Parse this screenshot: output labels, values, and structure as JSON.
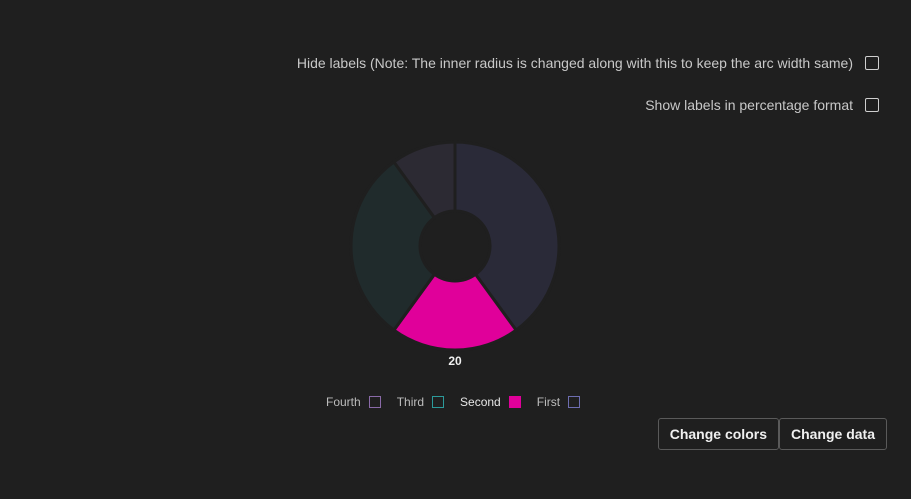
{
  "options": {
    "hide_labels": "Hide labels (Note: The inner radius is changed along with this to keep the arc width same)",
    "show_percentage": "Show labels in percentage format"
  },
  "buttons": {
    "change_colors": "Change colors",
    "change_data": "Change data"
  },
  "colors": {
    "background": "#1f1f1f",
    "first": "#2a2a38",
    "second": "#e0009a",
    "third": "#202b2c",
    "fourth": "#2c2a33",
    "first_legend_border": "#6d6db0",
    "third_legend_border": "#2c9a9a",
    "fourth_legend_border": "#8a6aa8"
  },
  "chart_data": {
    "type": "pie",
    "variant": "donut",
    "order": "clockwise from top",
    "slices": [
      {
        "name": "First",
        "value": 40,
        "color": "#2a2a38",
        "border": "#6d6db0",
        "highlighted": false
      },
      {
        "name": "Second",
        "value": 20,
        "color": "#e0009a",
        "border": "#e0009a",
        "highlighted": true
      },
      {
        "name": "Third",
        "value": 30,
        "color": "#202b2c",
        "border": "#2c9a9a",
        "highlighted": false
      },
      {
        "name": "Fourth",
        "value": 10,
        "color": "#2c2a33",
        "border": "#8a6aa8",
        "highlighted": false
      }
    ],
    "legend_order": [
      "Fourth",
      "Third",
      "Second",
      "First"
    ],
    "visible_labels": [
      "20"
    ]
  }
}
